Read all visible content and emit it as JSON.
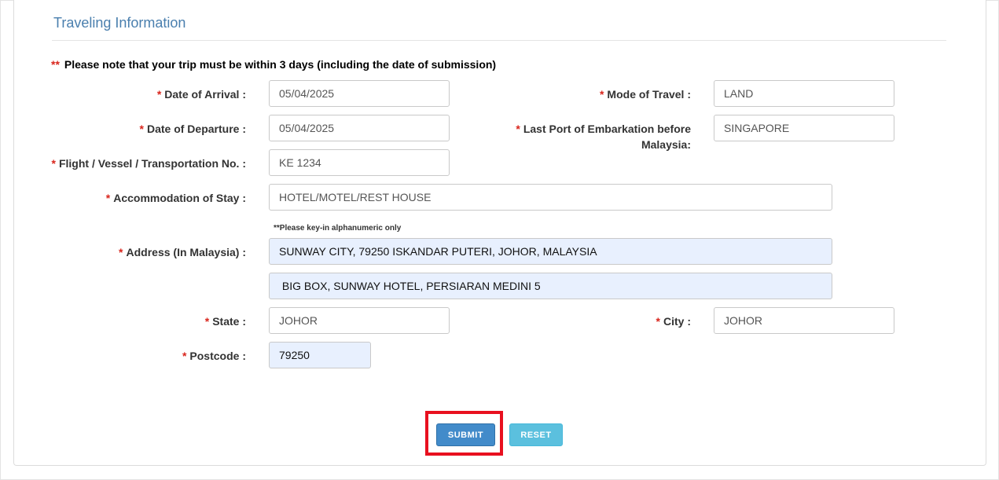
{
  "section_title": "Traveling Information",
  "note": {
    "stars": "**",
    "text": "Please note that your trip must be within 3 days (including the date of submission)"
  },
  "required_marker": "*",
  "fields": {
    "date_of_arrival": {
      "label": "Date of Arrival :",
      "value": "05/04/2025"
    },
    "mode_of_travel": {
      "label": "Mode of Travel :",
      "value": "LAND"
    },
    "date_of_departure": {
      "label": "Date of Departure :",
      "value": "05/04/2025"
    },
    "last_port": {
      "label_line1": "Last Port of Embarkation before",
      "label_line2": "Malaysia:",
      "value": "SINGAPORE"
    },
    "flight_no": {
      "label": "Flight / Vessel / Transportation No. :",
      "value": "KE 1234"
    },
    "accommodation": {
      "label": "Accommodation of Stay :",
      "value": "HOTEL/MOTEL/REST HOUSE"
    },
    "address": {
      "hint": "**Please key-in alphanumeric only",
      "label": "Address (In Malaysia) :",
      "line1": "SUNWAY CITY, 79250 ISKANDAR PUTERI, JOHOR, MALAYSIA",
      "line2": " BIG BOX, SUNWAY HOTEL, PERSIARAN MEDINI 5"
    },
    "state": {
      "label": "State :",
      "value": "JOHOR"
    },
    "city": {
      "label": "City :",
      "value": "JOHOR"
    },
    "postcode": {
      "label": "Postcode :",
      "value": "79250"
    }
  },
  "buttons": {
    "submit": "SUBMIT",
    "reset": "RESET"
  },
  "colors": {
    "title": "#4a7fae",
    "required": "#d9251c",
    "submit": "#428bca",
    "reset": "#5bc0de",
    "highlight": "#e8101f",
    "autofill_bg": "#e8f0fe"
  }
}
